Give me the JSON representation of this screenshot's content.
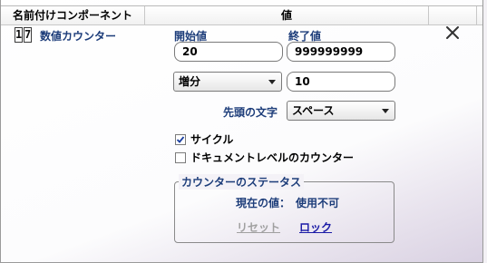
{
  "header": {
    "col_component": "名前付けコンポーネント",
    "col_value": "値"
  },
  "component": {
    "icon_digits": [
      "1",
      "7"
    ],
    "name": "数値カウンター"
  },
  "fields": {
    "start_label": "開始値",
    "start_value": "20",
    "end_label": "終了値",
    "end_value": "999999999",
    "step_mode": "増分",
    "step_value": "10",
    "prefix_label": "先頭の文字",
    "prefix_value": "スペース"
  },
  "options": {
    "cycle_label": "サイクル",
    "cycle_checked": true,
    "doc_level_label": "ドキュメントレベルのカウンター",
    "doc_level_checked": false
  },
  "status": {
    "legend": "カウンターのステータス",
    "current_label": "現在の値：",
    "current_value": "使用不可",
    "reset_label": "リセット",
    "lock_label": "ロック"
  },
  "icons": {
    "close": "close-icon",
    "dropdown": "chevron-down-icon",
    "check": "check-icon"
  },
  "colors": {
    "label_blue": "#1d3d7a",
    "link_blue": "#1a1aa6",
    "disabled_gray": "#a0a0a0"
  }
}
